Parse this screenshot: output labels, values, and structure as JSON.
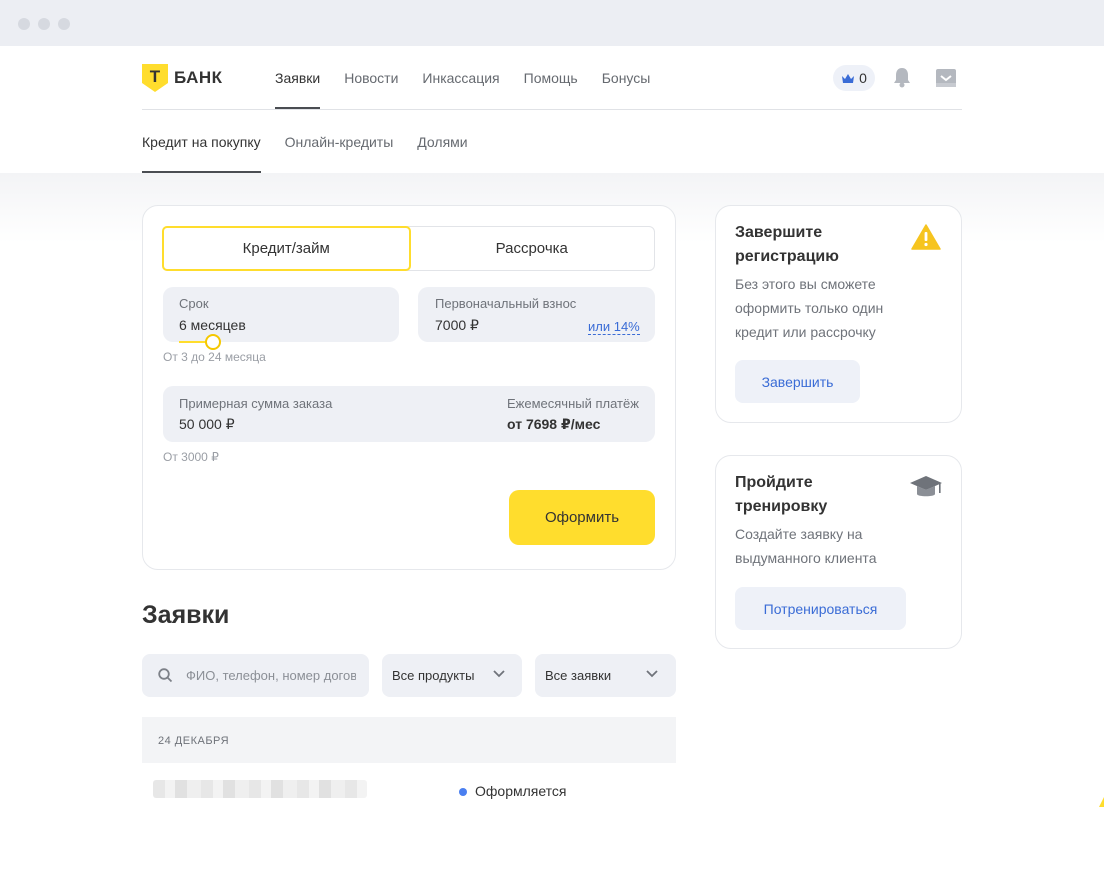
{
  "brand": {
    "name": "БАНК",
    "letter": "Т",
    "accent": "#ffdd2d"
  },
  "topnav": [
    {
      "label": "Заявки",
      "active": true
    },
    {
      "label": "Новости",
      "active": false
    },
    {
      "label": "Инкассация",
      "active": false
    },
    {
      "label": "Помощь",
      "active": false
    },
    {
      "label": "Бонусы",
      "active": false
    }
  ],
  "header_actions": {
    "crown_count": "0",
    "icons": [
      "crown-icon",
      "bell-icon",
      "inbox-icon"
    ]
  },
  "subnav": [
    {
      "label": "Кредит на покупку",
      "active": true
    },
    {
      "label": "Онлайн-кредиты",
      "active": false
    },
    {
      "label": "Долями",
      "active": false
    }
  ],
  "calculator": {
    "tabs": [
      {
        "label": "Кредит/займ",
        "active": true
      },
      {
        "label": "Рассрочка",
        "active": false
      }
    ],
    "term": {
      "label": "Срок",
      "value": "6 месяцев",
      "hint": "От 3 до 24 месяца",
      "slider_fraction": 0.14
    },
    "down_payment": {
      "label": "Первоначальный взнос",
      "value": "7000 ₽",
      "percent_link": "или 14%"
    },
    "order_sum": {
      "label": "Примерная сумма заказа",
      "value": "50 000 ₽",
      "hint": "От 3000 ₽"
    },
    "monthly": {
      "label": "Ежемесячный платёж",
      "value": "от 7698 ₽/мес"
    },
    "submit_label": "Оформить"
  },
  "applications": {
    "title": "Заявки",
    "search_placeholder": "ФИО, телефон, номер договора",
    "filter_products": "Все продукты",
    "filter_status": "Все заявки",
    "date_group": "24 ДЕКАБРЯ",
    "rows": [
      {
        "status": "Оформляется",
        "status_color": "#4a7ff0"
      }
    ]
  },
  "side_cards": {
    "registration": {
      "title": "Завершите регистрацию",
      "desc": "Без этого вы сможете оформить только один кредит или рассрочку",
      "button": "Завершить",
      "icon": "warning-icon"
    },
    "training": {
      "title": "Пройдите тренировку",
      "desc": "Создайте заявку на выдуманного клиента",
      "button": "Потренироваться",
      "icon": "graduation-cap-icon"
    }
  }
}
